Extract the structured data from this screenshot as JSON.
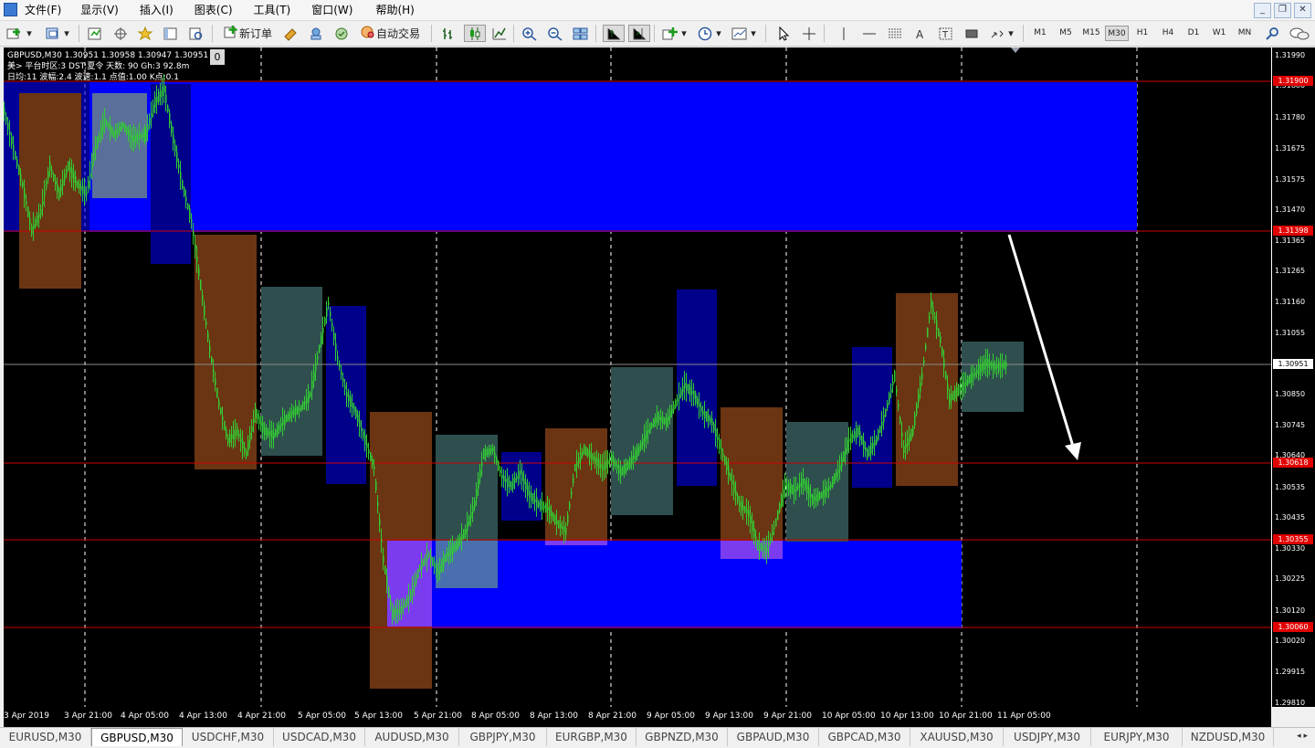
{
  "menu": {
    "items": [
      "文件(F)",
      "显示(V)",
      "插入(I)",
      "图表(C)",
      "工具(T)",
      "窗口(W)",
      "帮助(H)"
    ]
  },
  "window_buttons": [
    "_",
    "❐",
    "✕"
  ],
  "toolbar": {
    "new_order_label": "新订单",
    "autotrade_label": "自动交易",
    "timeframes": [
      "M1",
      "M5",
      "M15",
      "M30",
      "H1",
      "H4",
      "D1",
      "W1",
      "MN"
    ],
    "active_timeframe": "M30"
  },
  "chart": {
    "symbol_line": "GBPUSD,M30  1.30951 1.30958 1.30947 1.30951",
    "info_line2": "美> 平台时区:3  DST:夏令  天数:  90  Gh:3  92.8m",
    "info_line3": "日均:11  波幅:2.4  波速:1.1  点值:1.00  K点:0.1",
    "badge": "0",
    "colors": {
      "background": "#000000",
      "candle": "#32cd32",
      "zone": "#0000ff",
      "bearish_box": "#6b3513",
      "neutral_box": "#2f4f4f",
      "navy_box": "#00008b",
      "level_line": "#d00000"
    },
    "price_ticks": [
      "1.31990",
      "1.31880",
      "1.31780",
      "1.31675",
      "1.31575",
      "1.31470",
      "1.31365",
      "1.31265",
      "1.31160",
      "1.31055",
      "1.30850",
      "1.30745",
      "1.30640",
      "1.30535",
      "1.30435",
      "1.30330",
      "1.30225",
      "1.30120",
      "1.30020",
      "1.29915",
      "1.29810"
    ],
    "price_tags": {
      "current": "1.30951",
      "r1": "1.31900",
      "r2": "1.31398",
      "s1": "1.30618",
      "s2": "1.30355",
      "s3": "1.30060"
    },
    "time_labels": [
      "3 Apr 2019",
      "3 Apr 21:00",
      "4 Apr 05:00",
      "4 Apr 13:00",
      "4 Apr 21:00",
      "5 Apr 05:00",
      "5 Apr 13:00",
      "5 Apr 21:00",
      "8 Apr 05:00",
      "8 Apr 13:00",
      "8 Apr 21:00",
      "9 Apr 05:00",
      "9 Apr 13:00",
      "9 Apr 21:00",
      "10 Apr 05:00",
      "10 Apr 13:00",
      "10 Apr 21:00",
      "11 Apr 05:00"
    ]
  },
  "symbol_tabs": [
    "EURUSD,M30",
    "GBPUSD,M30",
    "USDCHF,M30",
    "USDCAD,M30",
    "AUDUSD,M30",
    "GBPJPY,M30",
    "EURGBP,M30",
    "GBPNZD,M30",
    "GBPAUD,M30",
    "GBPCAD,M30",
    "XAUUSD,M30",
    "USDJPY,M30",
    "EURJPY,M30",
    "NZDUSD,M30"
  ],
  "active_tab": "GBPUSD,M30",
  "tab_nav": "◂ ▸"
}
